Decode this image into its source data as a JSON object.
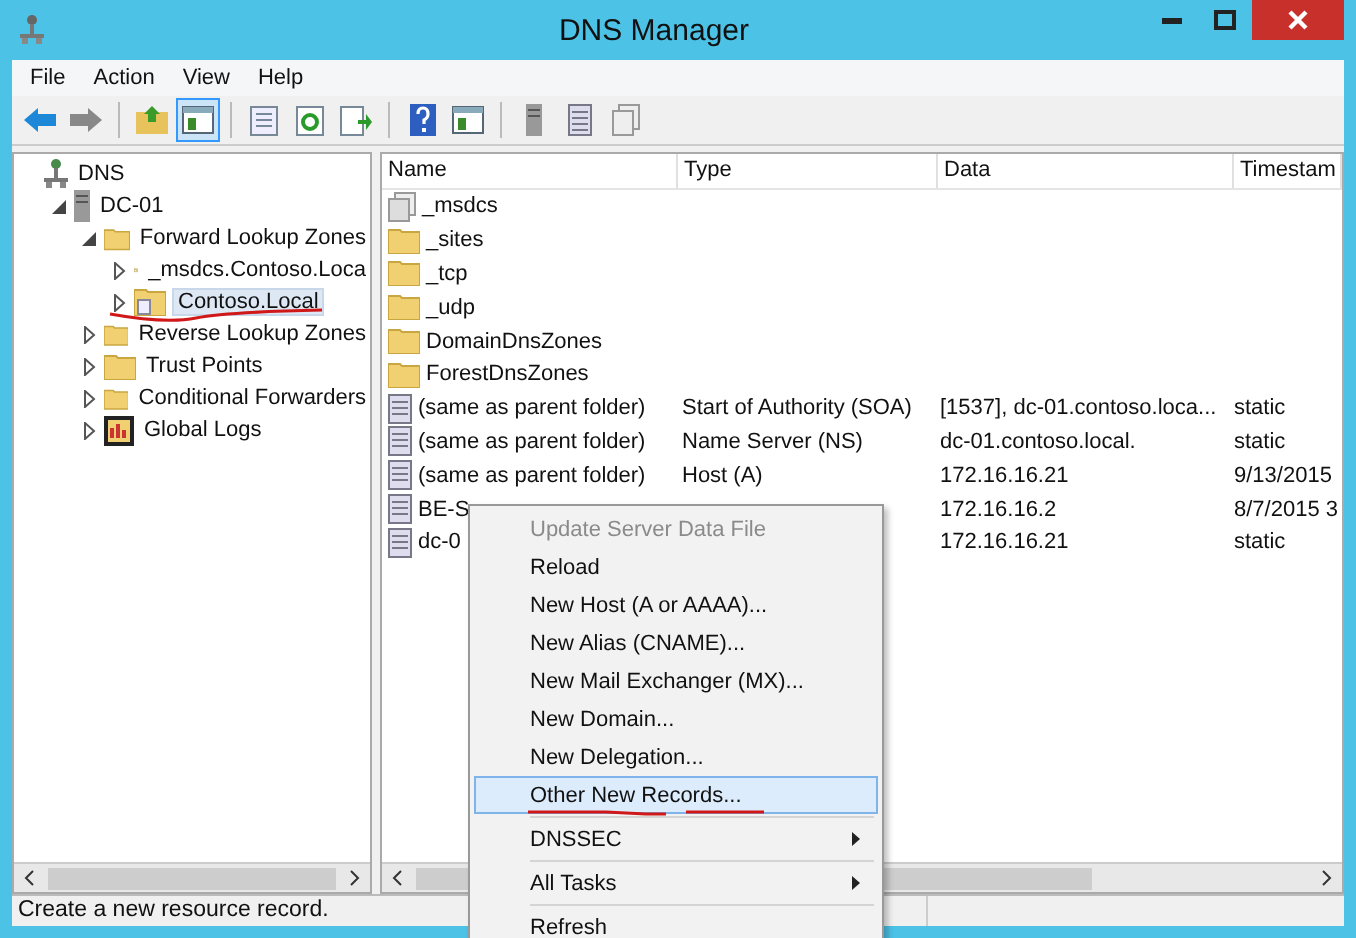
{
  "window": {
    "title": "DNS Manager"
  },
  "menu": [
    "File",
    "Action",
    "View",
    "Help"
  ],
  "toolbar": [
    {
      "kind": "back",
      "selected": false
    },
    {
      "kind": "forward",
      "selected": false
    },
    {
      "kind": "sep"
    },
    {
      "kind": "up",
      "selected": false
    },
    {
      "kind": "pane",
      "selected": true
    },
    {
      "kind": "sep"
    },
    {
      "kind": "props",
      "selected": false
    },
    {
      "kind": "refresh",
      "selected": false
    },
    {
      "kind": "export",
      "selected": false
    },
    {
      "kind": "sep"
    },
    {
      "kind": "help",
      "selected": false
    },
    {
      "kind": "pane",
      "selected": false
    },
    {
      "kind": "sep"
    },
    {
      "kind": "server",
      "selected": false
    },
    {
      "kind": "record",
      "selected": false
    },
    {
      "kind": "zone",
      "selected": false
    }
  ],
  "tree": [
    {
      "label": "DNS",
      "kind": "dns",
      "expanded": true,
      "selected": false,
      "children": [
        {
          "label": "DC-01",
          "kind": "server",
          "expanded": true,
          "selected": false,
          "children": [
            {
              "label": "Forward Lookup Zones",
              "kind": "folder",
              "expanded": true,
              "selected": false,
              "children": [
                {
                  "label": "_msdcs.Contoso.Loca",
                  "kind": "zone",
                  "expanded": false,
                  "selected": false
                },
                {
                  "label": "Contoso.Local",
                  "kind": "zone",
                  "expanded": false,
                  "selected": true
                }
              ]
            },
            {
              "label": "Reverse Lookup Zones",
              "kind": "folder",
              "expanded": false,
              "selected": false
            },
            {
              "label": "Trust Points",
              "kind": "folder",
              "expanded": false,
              "selected": false
            },
            {
              "label": "Conditional Forwarders",
              "kind": "folder",
              "expanded": false,
              "selected": false
            },
            {
              "label": "Global Logs",
              "kind": "log",
              "expanded": false,
              "selected": false
            }
          ]
        }
      ]
    }
  ],
  "table": {
    "columns": [
      "Name",
      "Type",
      "Data",
      "Timestam"
    ],
    "rows": [
      {
        "kind": "zone",
        "cells": [
          "_msdcs",
          "",
          "",
          ""
        ]
      },
      {
        "kind": "folder",
        "cells": [
          "_sites",
          "",
          "",
          ""
        ]
      },
      {
        "kind": "folder",
        "cells": [
          "_tcp",
          "",
          "",
          ""
        ]
      },
      {
        "kind": "folder",
        "cells": [
          "_udp",
          "",
          "",
          ""
        ]
      },
      {
        "kind": "folder",
        "cells": [
          "DomainDnsZones",
          "",
          "",
          ""
        ]
      },
      {
        "kind": "folder",
        "cells": [
          "ForestDnsZones",
          "",
          "",
          ""
        ]
      },
      {
        "kind": "record",
        "cells": [
          "(same as parent folder)",
          "Start of Authority (SOA)",
          "[1537], dc-01.contoso.loca...",
          "static"
        ]
      },
      {
        "kind": "record",
        "cells": [
          "(same as parent folder)",
          "Name Server (NS)",
          "dc-01.contoso.local.",
          "static"
        ]
      },
      {
        "kind": "record",
        "cells": [
          "(same as parent folder)",
          "Host (A)",
          "172.16.16.21",
          "9/13/2015"
        ]
      },
      {
        "kind": "record",
        "cells": [
          "BE-S",
          "",
          "172.16.16.2",
          "8/7/2015 3"
        ]
      },
      {
        "kind": "record",
        "cells": [
          "dc-0",
          "",
          "172.16.16.21",
          "static"
        ]
      }
    ]
  },
  "context_menu": [
    {
      "label": "Update Server Data File",
      "kind": "item",
      "disabled": true,
      "selected": false
    },
    {
      "label": "Reload",
      "kind": "item",
      "disabled": false,
      "selected": false
    },
    {
      "label": "New Host (A or AAAA)...",
      "kind": "item",
      "disabled": false,
      "selected": false
    },
    {
      "label": "New Alias (CNAME)...",
      "kind": "item",
      "disabled": false,
      "selected": false
    },
    {
      "label": "New Mail Exchanger (MX)...",
      "kind": "item",
      "disabled": false,
      "selected": false
    },
    {
      "label": "New Domain...",
      "kind": "item",
      "disabled": false,
      "selected": false
    },
    {
      "label": "New Delegation...",
      "kind": "item",
      "disabled": false,
      "selected": false
    },
    {
      "label": "Other New Records...",
      "kind": "item",
      "disabled": false,
      "selected": true
    },
    {
      "label": "DNSSEC",
      "kind": "submenu",
      "disabled": false,
      "selected": false
    },
    {
      "label": "All Tasks",
      "kind": "submenu",
      "disabled": false,
      "selected": false
    },
    {
      "label": "Refresh",
      "kind": "item",
      "disabled": false,
      "selected": false
    }
  ],
  "status_bar": "Create a new resource record."
}
